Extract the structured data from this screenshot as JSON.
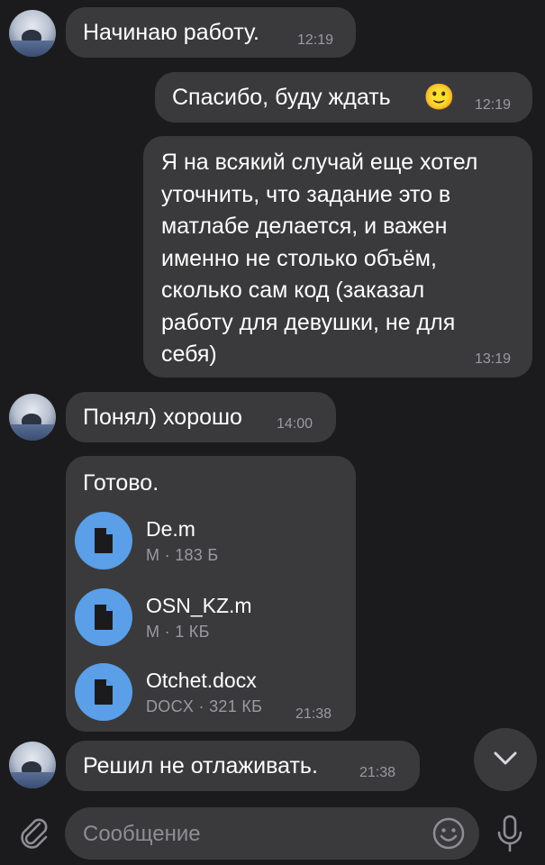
{
  "messages": [
    {
      "text": "Начинаю работу.",
      "time": "12:19"
    },
    {
      "text": "Спасибо, буду ждать",
      "emoji": "🙂",
      "time": "12:19"
    },
    {
      "lines": [
        "Я на всякий случай еще хотел",
        "уточнить, что задание это в",
        "матлабе делается, и важен",
        "именно не столько объём,",
        "сколько сам код (заказал",
        "работу для девушки, не для",
        "себя)"
      ],
      "time": "13:19"
    },
    {
      "text": "Понял) хорошо",
      "time": "14:00"
    },
    {
      "text": "Готово.",
      "time": "21:38",
      "files": [
        {
          "name": "De.m",
          "meta": "M · 183 Б"
        },
        {
          "name": "OSN_KZ.m",
          "meta": "M · 1 КБ"
        },
        {
          "name": "Otchet.docx",
          "meta": "DOCX · 321 КБ"
        }
      ]
    },
    {
      "text": "Решил не отлаживать.",
      "time": "21:38"
    }
  ],
  "input": {
    "placeholder": "Сообщение"
  },
  "icons": {
    "attach": "paperclip-icon",
    "emoji": "smile-icon",
    "mic": "microphone-icon",
    "scroll": "chevron-down-icon",
    "file": "document-icon"
  },
  "colors": {
    "background": "#1b1b1d",
    "bubble": "#3a3a3c",
    "file_icon": "#5a9fe8",
    "time": "#9a9aa0"
  }
}
